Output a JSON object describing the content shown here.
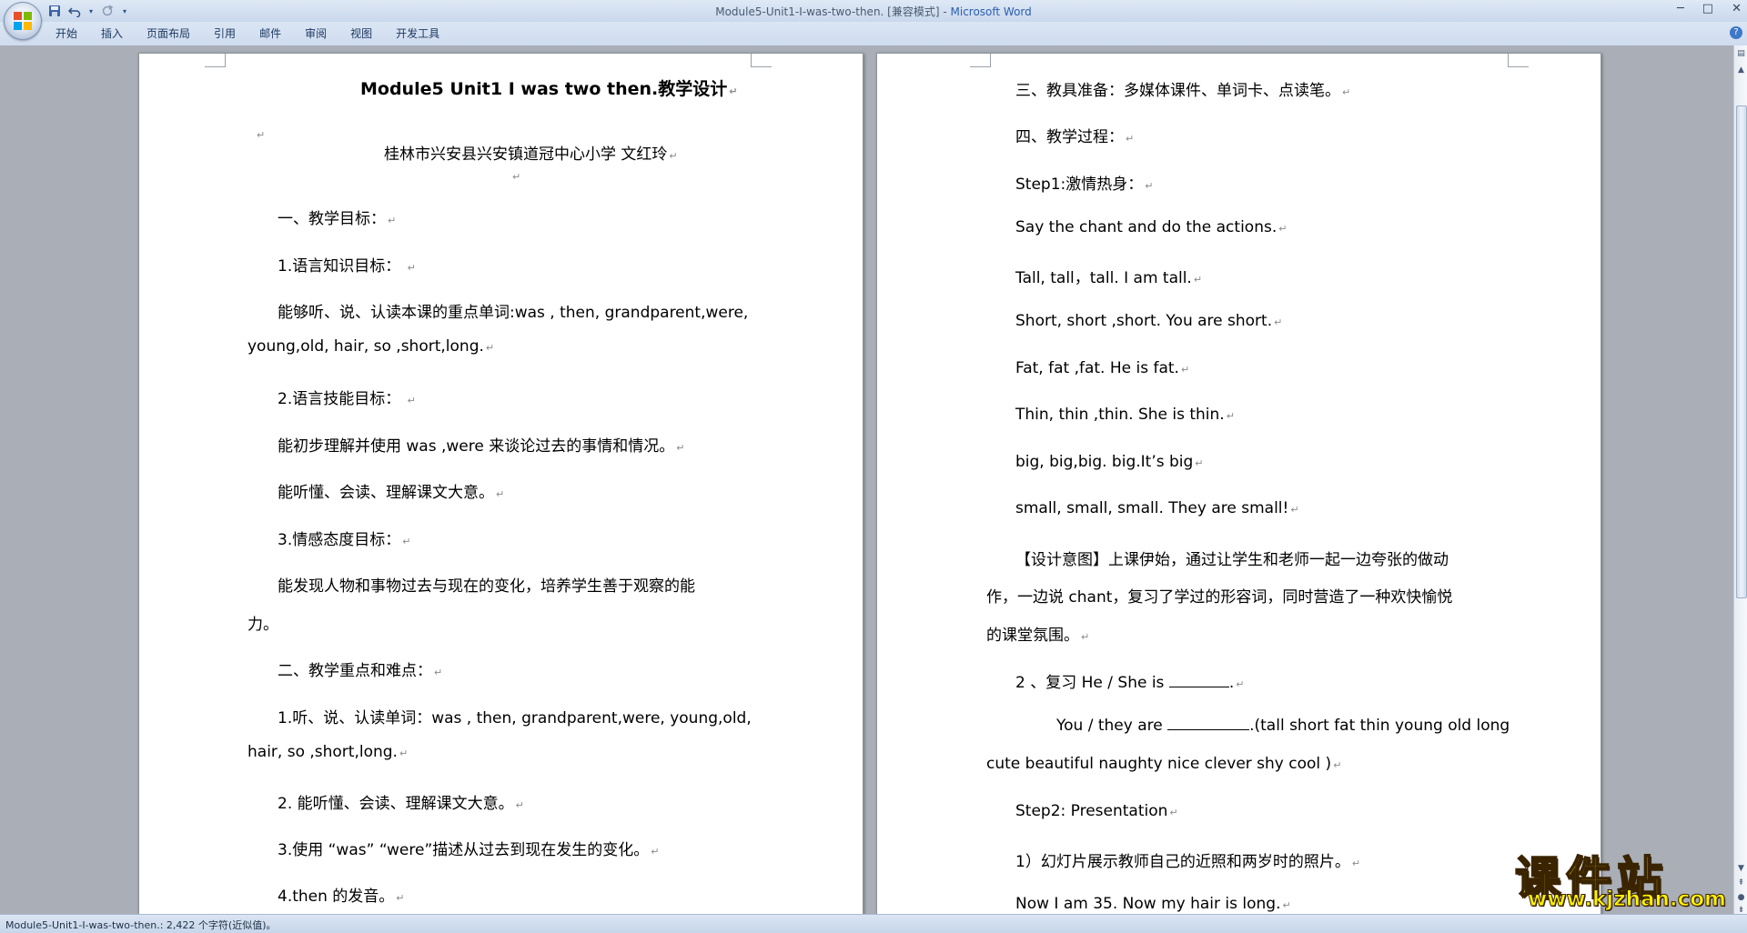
{
  "window": {
    "title_doc": "Module5-Unit1-I-was-two-then. [兼容模式] - ",
    "title_app": "Microsoft Word"
  },
  "ribbon": {
    "tabs": [
      "开始",
      "插入",
      "页面布局",
      "引用",
      "邮件",
      "审阅",
      "视图",
      "开发工具"
    ]
  },
  "page_left": {
    "lines": [
      "Module5 Unit1  I was two then.教学设计",
      "",
      "桂林市兴安县兴安镇道冠中心小学    文红玲",
      "",
      "一、教学目标：",
      "1.语言知识目标：  ",
      "能够听、说、认读本课的重点单词:was , then, grandparent,were,",
      "young,old, hair, so ,short,long.",
      "2.语言技能目标：  ",
      "能初步理解并使用 was ,were 来谈论过去的事情和情况。",
      "能听懂、会读、理解课文大意。",
      "3.情感态度目标：",
      "能发现人物和事物过去与现在的变化，培养学生善于观察的能",
      "力。",
      "二、教学重点和难点：",
      "1.听、说、认读单词：was , then, grandparent,were, young,old,",
      "hair, so ,short,long.",
      "2.  能听懂、会读、理解课文大意。",
      "3.使用 “was” “were”描述从过去到现在发生的变化。",
      "4.then 的发音。"
    ]
  },
  "page_right": {
    "lines": [
      "三、教具准备：多媒体课件、单词卡、点读笔。",
      "四、教学过程：",
      "Step1:激情热身：",
      "Say the chant and do the actions.",
      "Tall, tall，tall. I am tall.",
      "Short, short ,short. You are short.",
      "Fat, fat ,fat. He is fat.",
      "Thin, thin ,thin. She is thin.",
      "big, big,big. big.It’s big",
      "small, small, small. They are small!",
      "【设计意图】上课伊始，通过让学生和老师一起一边夸张的做动",
      "作，一边说 chant，复习了学过的形容词，同时营造了一种欢快愉悦",
      "的课堂氛围。",
      "2 、复习   He / She is ",
      "You / they are ",
      ".(tall short fat thin young old long",
      "cute beautiful naughty nice clever shy cool )",
      "Step2: Presentation",
      "1）幻灯片展示教师自己的近照和两岁时的照片。",
      "Now I am 35. Now my hair   is    long."
    ]
  },
  "status": {
    "text": "Module5-Unit1-I-was-two-then.: 2,422 个字符(近似值)。"
  },
  "watermark": {
    "big": "课件站",
    "url": "www.kjzhan.com"
  },
  "colors": {
    "accent": "#2a5fb0",
    "watermark_fill": "#fff200"
  }
}
